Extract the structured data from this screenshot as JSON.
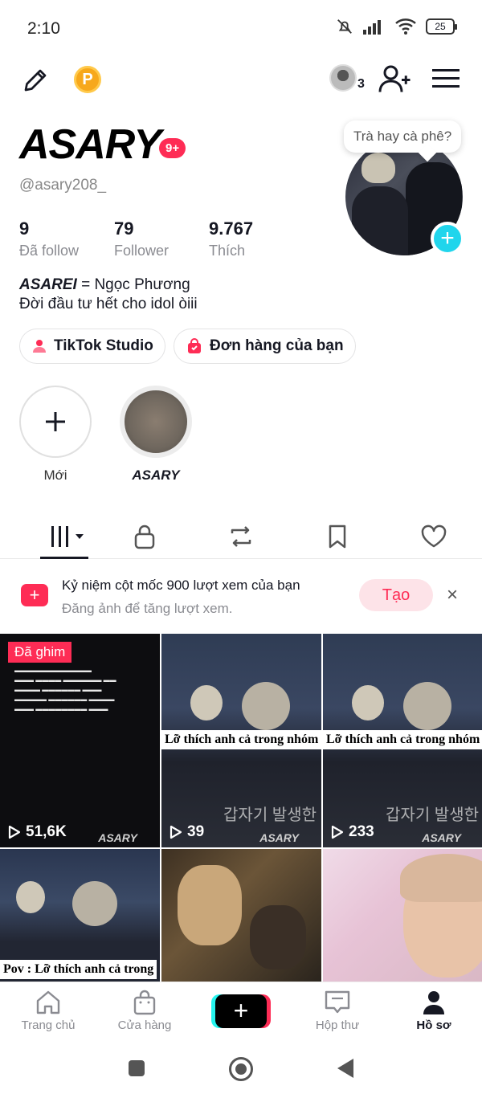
{
  "status_bar": {
    "time": "2:10",
    "battery": "25"
  },
  "top_bar": {
    "coin_label": "P",
    "friends_count": "3"
  },
  "profile": {
    "display_name": "ASARY",
    "notification_badge": "9+",
    "handle": "@asary208_",
    "stats": [
      {
        "value": "9",
        "label": "Đã follow"
      },
      {
        "value": "79",
        "label": "Follower"
      },
      {
        "value": "9.767",
        "label": "Thích"
      }
    ],
    "bio_name": "ASAREI",
    "bio_line1_rest": " = Ngọc Phương",
    "bio_line2": "Đời đầu tư hết cho idol òiii",
    "tooltip": "Trà hay cà phê?"
  },
  "buttons": {
    "studio": "TikTok Studio",
    "orders": "Đơn hàng của bạn"
  },
  "highlights": {
    "new_label": "Mới",
    "story_label": "ASARY"
  },
  "banner": {
    "title": "Kỷ niệm cột mốc 900 lượt xem của bạn",
    "subtitle": "Đăng ảnh để tăng lượt xem.",
    "create_label": "Tạo",
    "close": "×"
  },
  "videos": [
    {
      "plays": "51,6K",
      "pinned_label": "Đã ghim",
      "watermark": "ASARY"
    },
    {
      "plays": "39",
      "caption": "Lỡ thích anh cả trong nhóm",
      "watermark": "ASARY",
      "overlay": "갑자기 발생한"
    },
    {
      "plays": "233",
      "caption": "Lỡ thích anh cả trong nhóm",
      "watermark": "ASARY",
      "overlay": "갑자기 발생한"
    },
    {
      "caption": "Pov : Lỡ thích anh cả trong"
    },
    {},
    {}
  ],
  "nav": {
    "home": "Trang chủ",
    "shop": "Cửa hàng",
    "inbox": "Hộp thư",
    "profile": "Hồ sơ"
  }
}
